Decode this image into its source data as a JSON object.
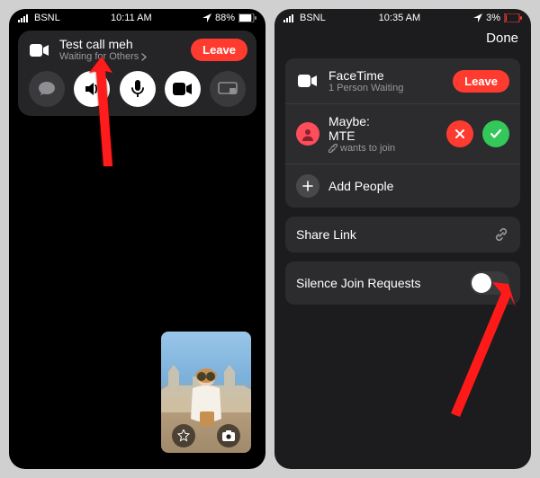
{
  "left": {
    "status": {
      "carrier": "BSNL",
      "time": "10:11 AM",
      "battery": "88%"
    },
    "call": {
      "title": "Test call meh",
      "subtitle": "Waiting for Others",
      "leave": "Leave"
    }
  },
  "right": {
    "status": {
      "carrier": "BSNL",
      "time": "10:35 AM",
      "battery": "3%"
    },
    "done": "Done",
    "facetime": {
      "title": "FaceTime",
      "subtitle": "1 Person Waiting",
      "leave": "Leave"
    },
    "request": {
      "prefix": "Maybe:",
      "name": "MTE",
      "sub": "wants to join"
    },
    "add_people": "Add People",
    "share_link": "Share Link",
    "silence": "Silence Join Requests"
  }
}
